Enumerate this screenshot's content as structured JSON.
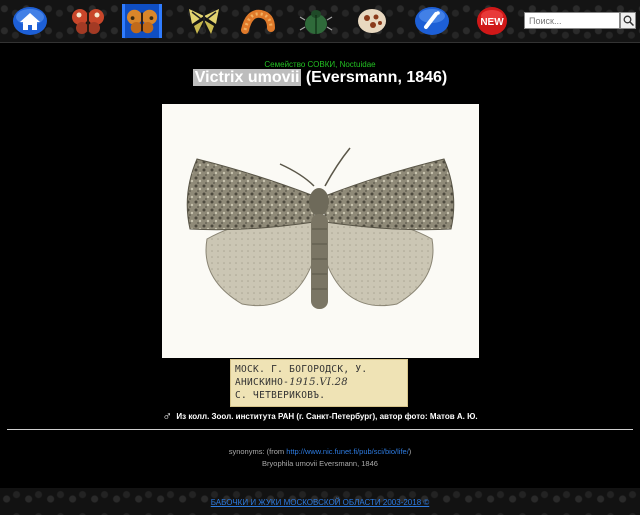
{
  "nav": {
    "search_placeholder": "Поиск..."
  },
  "family_line": "Семейство СОВКИ, Noctuidae",
  "title": {
    "species": "Victrix umovii",
    "author": "(Eversmann, 1846)"
  },
  "label": {
    "line1": "МОСК. Г. БОГОРОДСК, У.",
    "line2_printed": "АНИСКИНО-",
    "line2_handwritten": "1915.VI.28",
    "line3": "С. ЧЕТВЕРИКОВЪ."
  },
  "caption": {
    "symbol": "♂",
    "text": "Из колл. Зоол. института РАН (г. Санкт-Петербург), автор фото: Матов А. Ю."
  },
  "synonyms": {
    "prefix": "synonyms: (from ",
    "link": "http://www.nic.funet.fi/pub/sci/bio/life/",
    "suffix": ")",
    "name": "Bryophila umovii Eversmann, 1846"
  },
  "footer": {
    "link": "БАБОЧКИ И ЖУКИ МОСКОВСКОЙ ОБЛАСТИ 2003-2018 ©"
  },
  "colors": {
    "active_nav": "#0f4ec2",
    "family_green": "#22c022",
    "link_blue": "#2d7be0"
  }
}
